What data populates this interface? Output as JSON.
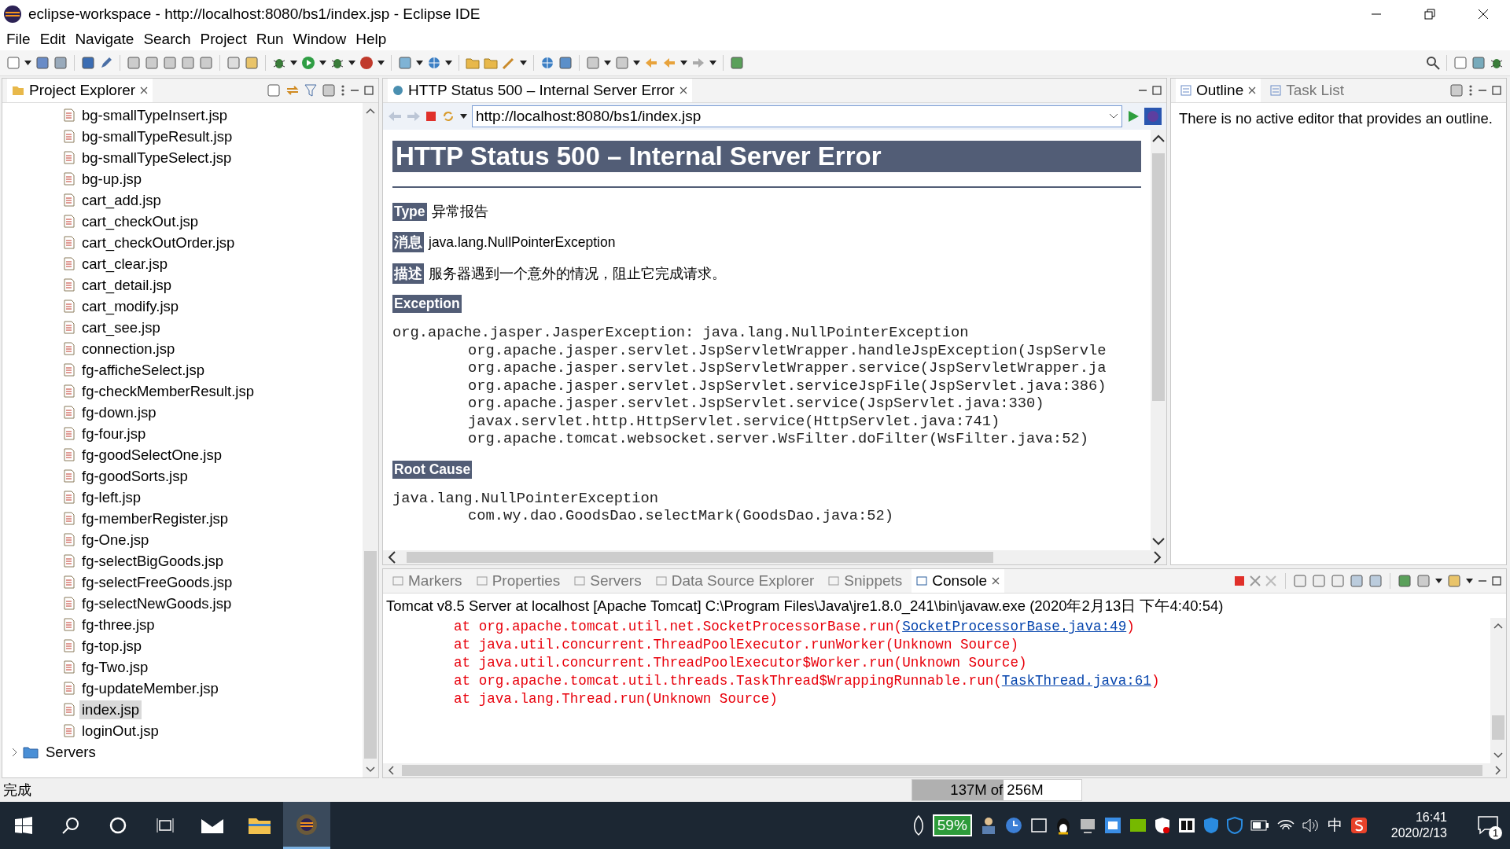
{
  "window": {
    "title": "eclipse-workspace - http://localhost:8080/bs1/index.jsp - Eclipse IDE"
  },
  "menu": [
    "File",
    "Edit",
    "Navigate",
    "Search",
    "Project",
    "Run",
    "Window",
    "Help"
  ],
  "project_explorer": {
    "title": "Project Explorer",
    "items": [
      {
        "label": "bg-smallTypeInsert.jsp",
        "selected": false
      },
      {
        "label": "bg-smallTypeResult.jsp",
        "selected": false
      },
      {
        "label": "bg-smallTypeSelect.jsp",
        "selected": false
      },
      {
        "label": "bg-up.jsp",
        "selected": false
      },
      {
        "label": "cart_add.jsp",
        "selected": false
      },
      {
        "label": "cart_checkOut.jsp",
        "selected": false
      },
      {
        "label": "cart_checkOutOrder.jsp",
        "selected": false
      },
      {
        "label": "cart_clear.jsp",
        "selected": false
      },
      {
        "label": "cart_detail.jsp",
        "selected": false
      },
      {
        "label": "cart_modify.jsp",
        "selected": false
      },
      {
        "label": "cart_see.jsp",
        "selected": false
      },
      {
        "label": "connection.jsp",
        "selected": false
      },
      {
        "label": "fg-afficheSelect.jsp",
        "selected": false
      },
      {
        "label": "fg-checkMemberResult.jsp",
        "selected": false
      },
      {
        "label": "fg-down.jsp",
        "selected": false
      },
      {
        "label": "fg-four.jsp",
        "selected": false
      },
      {
        "label": "fg-goodSelectOne.jsp",
        "selected": false
      },
      {
        "label": "fg-goodSorts.jsp",
        "selected": false
      },
      {
        "label": "fg-left.jsp",
        "selected": false
      },
      {
        "label": "fg-memberRegister.jsp",
        "selected": false
      },
      {
        "label": "fg-One.jsp",
        "selected": false
      },
      {
        "label": "fg-selectBigGoods.jsp",
        "selected": false
      },
      {
        "label": "fg-selectFreeGoods.jsp",
        "selected": false
      },
      {
        "label": "fg-selectNewGoods.jsp",
        "selected": false
      },
      {
        "label": "fg-three.jsp",
        "selected": false
      },
      {
        "label": "fg-top.jsp",
        "selected": false
      },
      {
        "label": "fg-Two.jsp",
        "selected": false
      },
      {
        "label": "fg-updateMember.jsp",
        "selected": false
      },
      {
        "label": "index.jsp",
        "selected": true
      },
      {
        "label": "loginOut.jsp",
        "selected": false
      }
    ],
    "folder": {
      "label": "Servers",
      "expanded": false
    }
  },
  "browser": {
    "tab": "HTTP Status 500 – Internal Server Error",
    "url": "http://localhost:8080/bs1/index.jsp",
    "heading": "HTTP Status 500 – Internal Server Error",
    "fields": [
      {
        "label": "Type",
        "value": "异常报告"
      },
      {
        "label": "消息",
        "value": "java.lang.NullPointerException"
      },
      {
        "label": "描述",
        "value": "服务器遇到一个意外的情况，阻止它完成请求。"
      }
    ],
    "sections": [
      {
        "title": "Exception",
        "lines": [
          {
            "text": "org.apache.jasper.JasperException: java.lang.NullPointerException",
            "children": [
              {
                "text": "org.apache.jasper.servlet.JspServletWrapper.handleJspException(JspServle"
              },
              {
                "text": "org.apache.jasper.servlet.JspServletWrapper.service(JspServletWrapper.ja"
              },
              {
                "text": "org.apache.jasper.servlet.JspServlet.serviceJspFile(JspServlet.java:386)"
              },
              {
                "text": "org.apache.jasper.servlet.JspServlet.service(JspServlet.java:330)"
              },
              {
                "text": "javax.servlet.http.HttpServlet.service(HttpServlet.java:741)"
              },
              {
                "text": "org.apache.tomcat.websocket.server.WsFilter.doFilter(WsFilter.java:52)"
              }
            ]
          }
        ]
      },
      {
        "title": "Root Cause",
        "lines": [
          {
            "text": "java.lang.NullPointerException",
            "children": [
              {
                "text": "com.wy.dao.GoodsDao.selectMark(GoodsDao.java:52)"
              }
            ]
          }
        ]
      }
    ]
  },
  "outline": {
    "tabs": [
      {
        "label": "Outline",
        "selected": true
      },
      {
        "label": "Task List",
        "selected": false
      }
    ],
    "message": "There is no active editor that provides an outline."
  },
  "console_tabs": [
    {
      "label": "Markers",
      "selected": false
    },
    {
      "label": "Properties",
      "selected": false
    },
    {
      "label": "Servers",
      "selected": false
    },
    {
      "label": "Data Source Explorer",
      "selected": false
    },
    {
      "label": "Snippets",
      "selected": false
    },
    {
      "label": "Console",
      "selected": true
    }
  ],
  "console": {
    "header": "Tomcat v8.5 Server at localhost [Apache Tomcat] C:\\Program Files\\Java\\jre1.8.0_241\\bin\\javaw.exe (2020年2月13日 下午4:40:54)",
    "lines": [
      {
        "text": "at org.apache.tomcat.util.net.SocketProcessorBase.run(",
        "link": "SocketProcessorBase.java:49",
        "after": ")"
      },
      {
        "text": "at java.util.concurrent.ThreadPoolExecutor.runWorker(Unknown Source)"
      },
      {
        "text": "at java.util.concurrent.ThreadPoolExecutor$Worker.run(Unknown Source)"
      },
      {
        "text": "at org.apache.tomcat.util.threads.TaskThread$WrappingRunnable.run(",
        "link": "TaskThread.java:61",
        "after": ")"
      },
      {
        "text": "at java.lang.Thread.run(Unknown Source)"
      }
    ]
  },
  "status_bar": {
    "text": "完成",
    "heap": "137M of 256M",
    "level": 0.54
  },
  "taskbar": {
    "battery": "59%",
    "ime": "中",
    "time": "16:41",
    "date": "2020/2/13",
    "notifications": "1"
  }
}
